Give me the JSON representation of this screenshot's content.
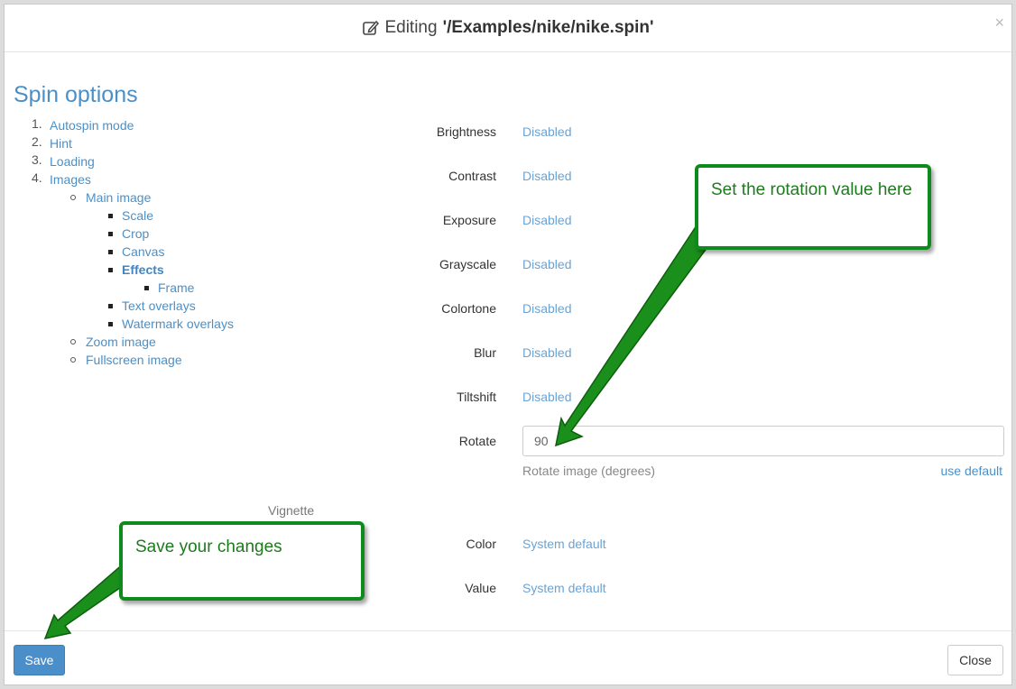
{
  "header": {
    "prefix": "Editing",
    "path": "'/Examples/nike/nike.spin'",
    "close_glyph": "×"
  },
  "sidebar": {
    "title": "Spin options",
    "items": [
      {
        "num": "1.",
        "label": "Autospin mode"
      },
      {
        "num": "2.",
        "label": "Hint"
      },
      {
        "num": "3.",
        "label": "Loading"
      },
      {
        "num": "4.",
        "label": "Images"
      },
      {
        "label": "Main image"
      },
      {
        "label": "Scale"
      },
      {
        "label": "Crop"
      },
      {
        "label": "Canvas"
      },
      {
        "label": "Effects"
      },
      {
        "label": "Frame"
      },
      {
        "label": "Text overlays"
      },
      {
        "label": "Watermark overlays"
      },
      {
        "label": "Zoom image"
      },
      {
        "label": "Fullscreen image"
      }
    ]
  },
  "effects": [
    {
      "label": "Brightness",
      "value": "Disabled"
    },
    {
      "label": "Contrast",
      "value": "Disabled"
    },
    {
      "label": "Exposure",
      "value": "Disabled"
    },
    {
      "label": "Grayscale",
      "value": "Disabled"
    },
    {
      "label": "Colortone",
      "value": "Disabled"
    },
    {
      "label": "Blur",
      "value": "Disabled"
    },
    {
      "label": "Tiltshift",
      "value": "Disabled"
    }
  ],
  "rotate": {
    "label": "Rotate",
    "value": "90",
    "help": "Rotate image (degrees)",
    "use_default": "use default"
  },
  "vignette": {
    "heading": "Vignette",
    "rows": [
      {
        "label": "Color",
        "value": "System default"
      },
      {
        "label": "Value",
        "value": "System default"
      }
    ]
  },
  "footer": {
    "save_label": "Save",
    "close_label": "Close"
  },
  "callouts": {
    "rotation": "Set the rotation value here",
    "save": "Save your changes"
  },
  "colors": {
    "link": "#4a90c8",
    "primary_button": "#4a8fc9",
    "callout_border": "#0f8a1c"
  },
  "icons": {
    "edit": "edit-icon",
    "close": "close-icon"
  }
}
